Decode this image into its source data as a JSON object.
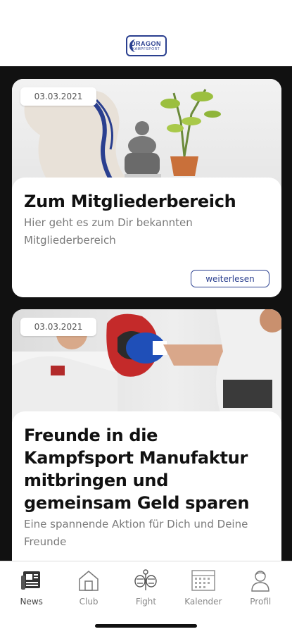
{
  "header": {
    "logo_text_top": "DRAGON",
    "logo_text_bottom": "KAMPFSPORT"
  },
  "posts": [
    {
      "date": "03.03.2021",
      "title": "Zum Mitgliederbereich",
      "excerpt": "Hier geht es zum Dir bekannten Mitgliederbereich",
      "read_more": "weiterlesen"
    },
    {
      "date": "03.03.2021",
      "title": "Freunde in die Kampfsport Manufaktur mitbringen und gemeinsam Geld sparen",
      "excerpt": "Eine spannende Aktion für Dich und Deine Freunde"
    }
  ],
  "tabbar": {
    "items": [
      {
        "label": "News",
        "icon": "newspaper-icon"
      },
      {
        "label": "Club",
        "icon": "house-icon"
      },
      {
        "label": "Fight",
        "icon": "fighter-icon"
      },
      {
        "label": "Kalender",
        "icon": "calendar-icon"
      },
      {
        "label": "Profil",
        "icon": "person-icon"
      }
    ],
    "active": "News"
  },
  "colors": {
    "brand": "#2a3f8f",
    "feed_background": "#111111",
    "text": "#111111",
    "muted": "#7a7a7a"
  }
}
